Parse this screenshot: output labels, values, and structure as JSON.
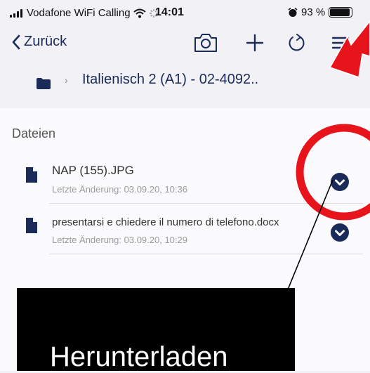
{
  "status_bar": {
    "carrier": "Vodafone WiFi Calling",
    "time": "14:01",
    "battery": "93 %",
    "battery_level": 0.93,
    "icons": [
      "signal-icon",
      "wifi-icon",
      "loading-icon",
      "alarm-icon",
      "battery-icon"
    ]
  },
  "nav": {
    "back_label": "Zurück",
    "icons": [
      "chevron-left-icon",
      "camera-icon",
      "plus-icon",
      "refresh-icon",
      "menu-icon"
    ]
  },
  "breadcrumb": {
    "separator": "›",
    "title": "Italienisch 2 (A1) - 02-4092.."
  },
  "files": {
    "section_title": "Dateien",
    "items": [
      {
        "name": "NAP (155).JPG",
        "modified": "Letzte Änderung: 03.09.20, 10:36"
      },
      {
        "name": "presentarsi e chiedere il numero di telefono.docx",
        "modified": "Letzte Änderung: 03.09.20, 10:29"
      }
    ]
  },
  "annotation": {
    "callout_text": "Herunterladen",
    "highlight_color": "#e8141b"
  },
  "colors": {
    "brand": "#1a2b5a",
    "background": "#f2f1f6",
    "list_background": "#fbfbfd"
  }
}
